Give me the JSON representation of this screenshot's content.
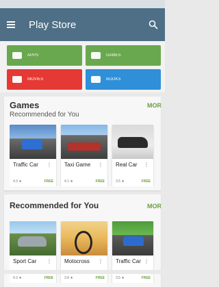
{
  "app_bar": {
    "title": "Play Store"
  },
  "categories": [
    {
      "label": "APPS",
      "color": "#6aa84f",
      "icon": "android-icon"
    },
    {
      "label": "GAMES",
      "color": "#6aa84f",
      "icon": "gamepad-icon"
    },
    {
      "label": "MOVIES",
      "color": "#e53935",
      "icon": "film-icon"
    },
    {
      "label": "BOOKS",
      "color": "#2f8fd8",
      "icon": "book-icon"
    }
  ],
  "sections": [
    {
      "title": "Games",
      "subtitle": "Recommended for You",
      "more_label": "MORE",
      "cards": [
        {
          "title": "Traffic Car",
          "rating": "4.3 ★",
          "price": "FREE",
          "thumb": "t-road1"
        },
        {
          "title": "Taxi Game",
          "rating": "4.1 ★",
          "price": "FREE",
          "thumb": "t-taxi"
        },
        {
          "title": "Real Car",
          "rating": "3.5 ★",
          "price": "FREE",
          "thumb": "t-car"
        }
      ]
    },
    {
      "title": "Recommended for You",
      "subtitle": "",
      "more_label": "MORE",
      "cards": [
        {
          "title": "Sport Car",
          "rating": "4.3 ★",
          "price": "FREE",
          "thumb": "t-sport"
        },
        {
          "title": "Motocross",
          "rating": "3.8 ★",
          "price": "FREE",
          "thumb": "t-moto"
        },
        {
          "title": "Traffic Car",
          "rating": "3.5 ★",
          "price": "FREE",
          "thumb": "t-road2"
        }
      ]
    }
  ]
}
